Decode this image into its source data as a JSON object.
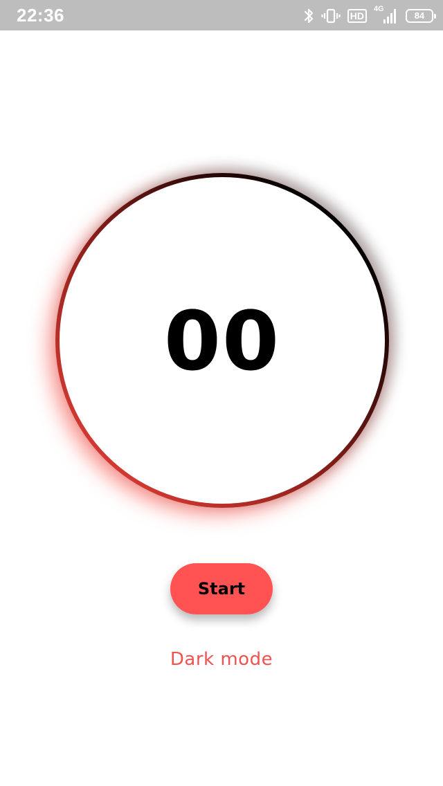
{
  "status_bar": {
    "time": "22:36",
    "network_label": "4G",
    "hd_label": "HD",
    "battery_level": "84",
    "icons": [
      "bluetooth-icon",
      "vibrate-icon",
      "hd-icon",
      "signal-icon",
      "battery-icon"
    ]
  },
  "timer": {
    "value": "00"
  },
  "actions": {
    "start_label": "Start",
    "dark_mode_label": "Dark mode"
  },
  "colors": {
    "accent": "#ff5252",
    "link": "#ef5350",
    "ring_start": "#f5453d",
    "ring_end": "#000000",
    "status_bar": "#bdbdbd"
  }
}
